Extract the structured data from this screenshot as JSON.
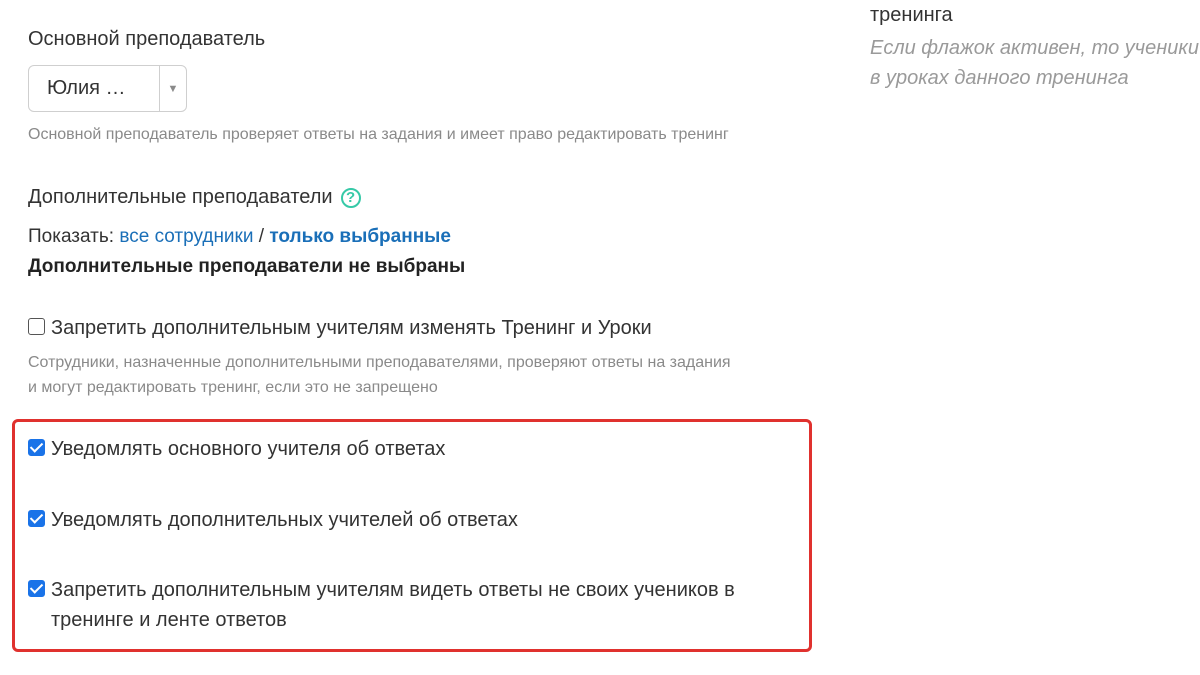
{
  "main_teacher": {
    "label": "Основной преподаватель",
    "selected": "Юлия …",
    "hint": "Основной преподаватель проверяет ответы на задания и имеет право редактировать тренинг"
  },
  "additional_teachers": {
    "label": "Дополнительные преподаватели",
    "show_prefix": "Показать:",
    "show_all": "все сотрудники",
    "separator": "/",
    "show_selected": "только выбранные",
    "none_selected": "Дополнительные преподаватели не выбраны"
  },
  "forbid_edit": {
    "label": "Запретить дополнительным учителям изменять Тренинг и Уроки",
    "checked": false,
    "hint_line1": "Сотрудники, назначенные дополнительными преподавателями, проверяют ответы на задания",
    "hint_line2": "и могут редактировать тренинг, если это не запрещено"
  },
  "notify_options": [
    {
      "label": "Уведомлять основного учителя об ответах",
      "checked": true
    },
    {
      "label": "Уведомлять дополнительных учителей об ответах",
      "checked": true
    },
    {
      "label": "Запретить дополнительным учителям видеть ответы не своих учеников в тренинге и ленте ответов",
      "checked": true
    }
  ],
  "right_column": {
    "title": "тренинга",
    "hint_line1": "Если флажок активен, то ученики",
    "hint_line2": "в уроках данного тренинга"
  },
  "colors": {
    "link": "#1a6fb8",
    "help_icon": "#36c9a7",
    "highlight_border": "#e0312e",
    "checkbox_checked": "#1a73e8"
  },
  "icons": {
    "help": "question-circle-icon",
    "dropdown": "triangle-down-icon"
  }
}
